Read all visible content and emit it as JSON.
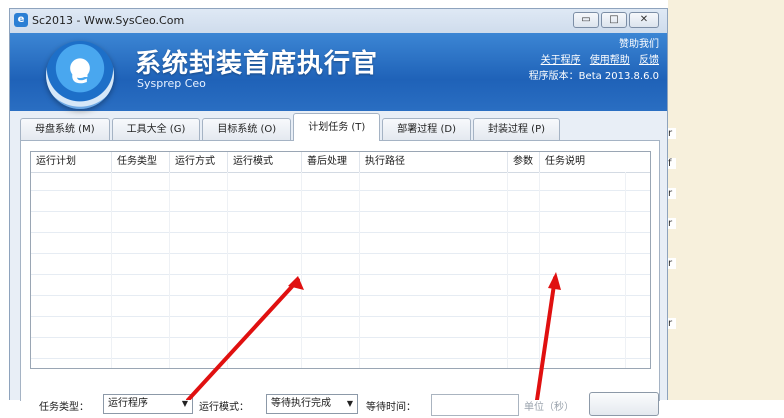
{
  "window": {
    "title": "Sc2013 - Www.SysCeo.Com",
    "icon": "e-logo-icon",
    "buttons": {
      "minimize": "▭",
      "maximize": "□",
      "close": "✕"
    }
  },
  "banner": {
    "logo_glyph": "e",
    "title": "系统封装首席执行官",
    "subtitle": "Sysprep Ceo",
    "donate": "赞助我们",
    "links": [
      "关于程序",
      "使用帮助",
      "反馈"
    ],
    "version": "程序版本：Beta 2013.8.6.0"
  },
  "tabs": [
    {
      "label": "母盘系统 (M)",
      "active": false
    },
    {
      "label": "工具大全 (G)",
      "active": false
    },
    {
      "label": "目标系统 (O)",
      "active": false
    },
    {
      "label": "计划任务 (T)",
      "active": true
    },
    {
      "label": "部署过程 (D)",
      "active": false
    },
    {
      "label": "封装过程 (P)",
      "active": false
    }
  ],
  "grid": {
    "columns": [
      "运行计划",
      "任务类型",
      "运行方式",
      "运行模式",
      "善后处理",
      "执行路径",
      "参数",
      "任务说明"
    ],
    "rows": []
  },
  "form": {
    "task_type_label": "任务类型：",
    "task_type_value": "运行程序",
    "run_mode_label": "运行模式：",
    "run_mode_value": "等待执行完成",
    "wait_time_label": "等待时间：",
    "wait_time_value": "",
    "unit": "单位（秒）"
  },
  "right_strip_chars": [
    "r",
    "f",
    "r",
    "r",
    "r",
    "r"
  ],
  "colors": {
    "banner": "#1f62b8",
    "arrow": "#e01010",
    "page_strip": "#f7f0dc"
  }
}
